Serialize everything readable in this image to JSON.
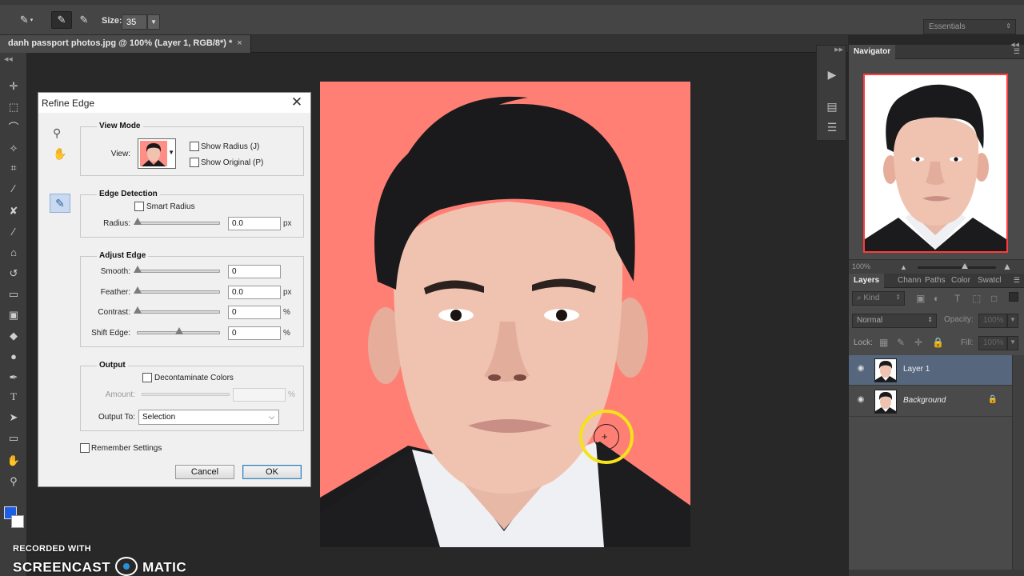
{
  "options_bar": {
    "size_label": "Size:",
    "size_value": "35",
    "workspace": "Essentials"
  },
  "document": {
    "tab_title": "danh passport photos.jpg @ 100% (Layer 1, RGB/8*) *",
    "background_color": "#ff7f75"
  },
  "toolbar": {
    "tools": [
      "move-icon",
      "marquee-icon",
      "lasso-icon",
      "quick-select-icon",
      "crop-icon",
      "eyedropper-icon",
      "healing-brush-icon",
      "brush-icon",
      "clone-stamp-icon",
      "history-brush-icon",
      "eraser-icon",
      "gradient-icon",
      "blur-icon",
      "dodge-icon",
      "pen-icon",
      "type-icon",
      "path-select-icon",
      "shape-icon",
      "hand-icon",
      "zoom-icon"
    ],
    "foreground_color": "#1c5fe6",
    "background_color": "#ffffff"
  },
  "navigator": {
    "title": "Navigator",
    "zoom": "100%",
    "zoom_level": 0.6
  },
  "layers_panel": {
    "tabs": [
      "Layers",
      "Chann",
      "Paths",
      "Color",
      "Swatcl"
    ],
    "active_tab": "Layers",
    "filter_kind": "Kind",
    "blend_mode": "Normal",
    "opacity_label": "Opacity:",
    "opacity_value": "100%",
    "lock_label": "Lock:",
    "fill_label": "Fill:",
    "fill_value": "100%",
    "layers": [
      {
        "name": "Layer 1",
        "selected": true,
        "locked": false
      },
      {
        "name": "Background",
        "selected": false,
        "locked": true
      }
    ]
  },
  "dialog": {
    "title": "Refine Edge",
    "view_mode": {
      "title": "View Mode",
      "view_label": "View:",
      "show_radius": "Show Radius (J)",
      "show_original": "Show Original (P)"
    },
    "edge_detection": {
      "title": "Edge Detection",
      "smart_radius": "Smart Radius",
      "radius_label": "Radius:",
      "radius_value": "0.0",
      "radius_unit": "px"
    },
    "adjust_edge": {
      "title": "Adjust Edge",
      "smooth_label": "Smooth:",
      "smooth_value": "0",
      "feather_label": "Feather:",
      "feather_value": "0.0",
      "feather_unit": "px",
      "contrast_label": "Contrast:",
      "contrast_value": "0",
      "contrast_unit": "%",
      "shift_label": "Shift Edge:",
      "shift_value": "0",
      "shift_unit": "%"
    },
    "output": {
      "title": "Output",
      "decontaminate": "Decontaminate Colors",
      "amount_label": "Amount:",
      "amount_unit": "%",
      "output_to_label": "Output To:",
      "output_to_value": "Selection"
    },
    "remember_settings": "Remember Settings",
    "cancel_label": "Cancel",
    "ok_label": "OK"
  },
  "watermark": {
    "line1": "RECORDED WITH",
    "line2_a": "SCREENCAST",
    "line2_b": "MATIC"
  }
}
